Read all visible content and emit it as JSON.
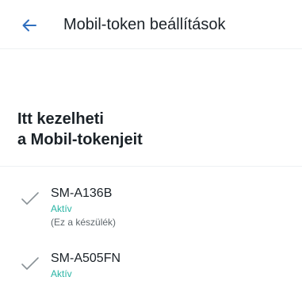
{
  "header": {
    "title": "Mobil-token beállítások",
    "back_icon": "arrow-left-icon",
    "accent_color": "#2f6fbf"
  },
  "intro": {
    "title_line1": "Itt kezelheti",
    "title_line2": "a Mobil-tokenjeit"
  },
  "devices": [
    {
      "name": "SM-A136B",
      "status": "Aktív",
      "note": "(Ez a készülék)",
      "icon": "check-icon"
    },
    {
      "name": "SM-A505FN",
      "status": "Aktív",
      "icon": "check-icon"
    }
  ],
  "colors": {
    "status_active": "#2bb5a5",
    "text_primary": "#1b2228",
    "text_secondary": "#5f676c"
  }
}
